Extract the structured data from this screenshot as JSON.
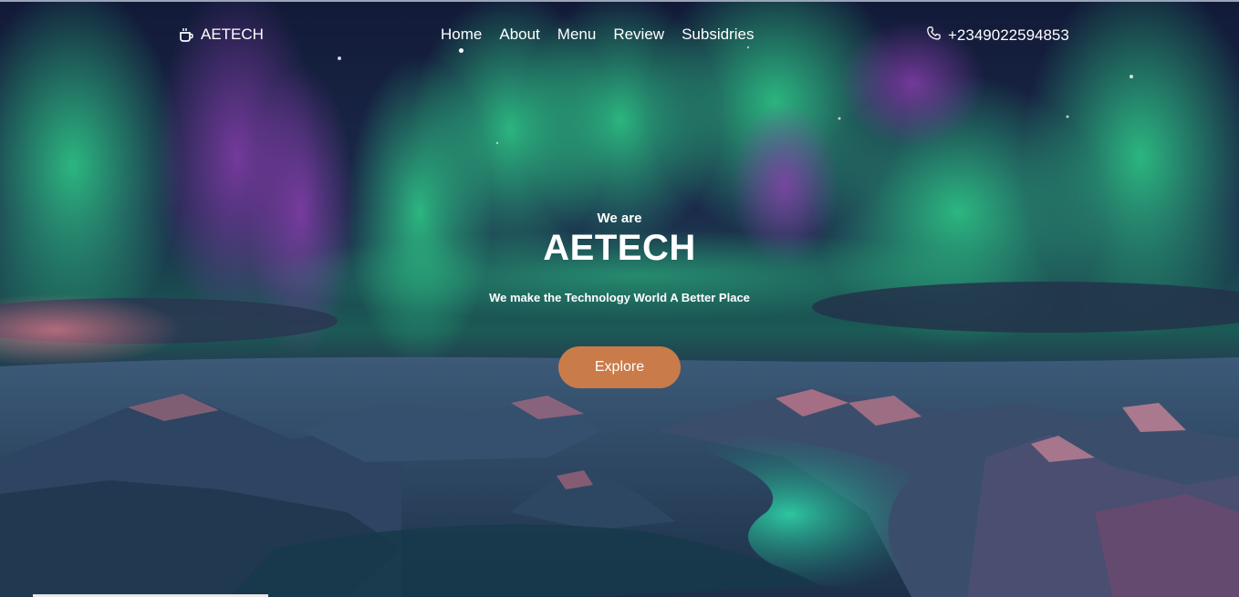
{
  "brand": {
    "name": "AETECH",
    "icon": "coffee-cup-icon"
  },
  "nav": {
    "items": [
      {
        "label": "Home",
        "active": true
      },
      {
        "label": "About",
        "active": false
      },
      {
        "label": "Menu",
        "active": false
      },
      {
        "label": "Review",
        "active": false
      },
      {
        "label": "Subsidries",
        "active": false
      }
    ]
  },
  "contact": {
    "phone": "+2349022594853",
    "icon": "phone-icon"
  },
  "hero": {
    "kicker": "We are",
    "title": "AETECH",
    "tagline": "We make the Technology World A Better Place",
    "cta_label": "Explore"
  },
  "colors": {
    "cta": "#c97b4a",
    "aurora_green": "#1fae7a",
    "aurora_purple": "#6a2f8f",
    "sky": "#0d1630"
  }
}
